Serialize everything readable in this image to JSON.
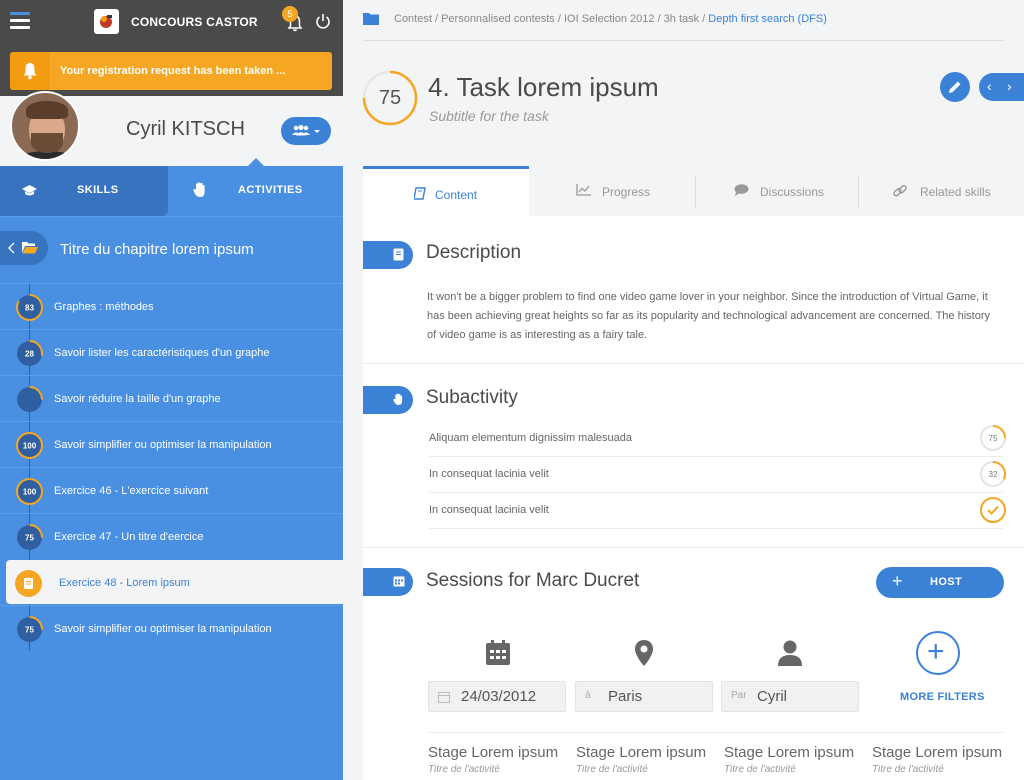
{
  "app": {
    "brand": "CONCOURS CASTOR",
    "notif_count": "5",
    "banner": "Your registration request has been taken ..."
  },
  "user": {
    "name": "Cyril KITSCH"
  },
  "sidebar": {
    "tabs": [
      {
        "label": "SKILLS"
      },
      {
        "label": "ACTIVITIES"
      }
    ],
    "chapter_title": "Titre du chapitre lorem ipsum",
    "items": [
      {
        "score": "83",
        "label": "Graphes : méthodes",
        "progress": 0.83
      },
      {
        "score": "28",
        "label": "Savoir lister les caractéristiques d'un graphe",
        "progress": 0.28
      },
      {
        "score": "",
        "label": "Savoir réduire la taille d'un graphe",
        "progress": 0.25
      },
      {
        "score": "100",
        "label": "Savoir simplifier ou optimiser la manipulation",
        "progress": 1.0
      },
      {
        "score": "100",
        "label": "Exercice 46 - L'exercice suivant",
        "progress": 1.0
      },
      {
        "score": "75",
        "label": "Exercice 47 - Un titre d'eercice",
        "progress": 0.25
      },
      {
        "score": "",
        "label": "Exercice 48 - Lorem ipsum",
        "progress": 0,
        "active": true
      },
      {
        "score": "75",
        "label": "Savoir simplifier ou optimiser la manipulation",
        "progress": 0.25
      }
    ]
  },
  "breadcrumb": {
    "path": "Contest / Personnalised contests / IOI Selection 2012 / 3h task / ",
    "current": "Depth first search (DFS)"
  },
  "task": {
    "score": "75",
    "score_progress": 0.75,
    "title": "4. Task lorem ipsum",
    "subtitle": "Subtitle for the task"
  },
  "tabs": [
    {
      "label": "Content"
    },
    {
      "label": "Progress"
    },
    {
      "label": "Discussions"
    },
    {
      "label": "Related skills"
    }
  ],
  "description": {
    "title": "Description",
    "text": "It won't be a bigger problem to find one video game lover in your neighbor. Since the introduction of Virtual Game, it has been achieving great heights so far as its popularity and technological advancement are concerned. The history of video game is as interesting as a fairy tale."
  },
  "subactivity": {
    "title": "Subactivity",
    "items": [
      {
        "label": "Aliquam elementum dignissim malesuada",
        "score": "75",
        "progress": 0.25
      },
      {
        "label": "In consequat lacinia velit",
        "score": "32",
        "progress": 0.32
      },
      {
        "label": "In consequat lacinia velit",
        "score": "",
        "progress": 1.0,
        "done": true
      }
    ]
  },
  "sessions": {
    "title": "Sessions for Marc Ducret",
    "host_label": "HOST",
    "date": "24/03/2012",
    "place_prefix": "à",
    "place": "Paris",
    "by_prefix": "Par",
    "by": "Cyril",
    "more_filters": "MORE FILTERS",
    "stages": [
      {
        "title": "Stage Lorem ipsum",
        "sub": "Titre de l'activité"
      },
      {
        "title": "Stage Lorem ipsum",
        "sub": "Titre de l'activité"
      },
      {
        "title": "Stage Lorem ipsum",
        "sub": "Titre de l'activité"
      },
      {
        "title": "Stage Lorem ipsum",
        "sub": "Titre de l'activité"
      }
    ]
  },
  "colors": {
    "primary": "#3b82d6",
    "sidebar": "#4a90e2",
    "accent": "#f5a623",
    "dark": "#4a4a4a"
  }
}
